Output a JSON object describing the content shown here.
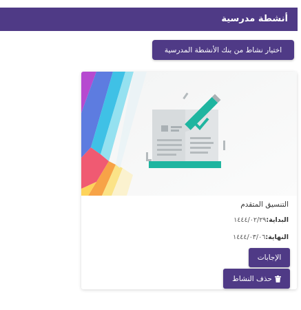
{
  "header": {
    "title": "أنشطة مدرسية"
  },
  "toolbar": {
    "bank_button_label": "اختيار نشاط من بنك الأنشطة المدرسية"
  },
  "activity": {
    "title": "التنسيق المتقدم",
    "start_label": "البداية:",
    "start_date": "١٤٤٤/٠٢/٢٩",
    "end_label": "النهاية:",
    "end_date": "١٤٤٤/٠٣/٠٦",
    "answers_label": "الإجابات",
    "delete_label": "حذف النشاط",
    "delete_icon": "trash-icon",
    "image_icon": "open-book-pen-icon"
  },
  "colors": {
    "primary": "#4f3a86",
    "book_teal": "#1fb5a0",
    "book_gray": "#cfd4d6"
  }
}
